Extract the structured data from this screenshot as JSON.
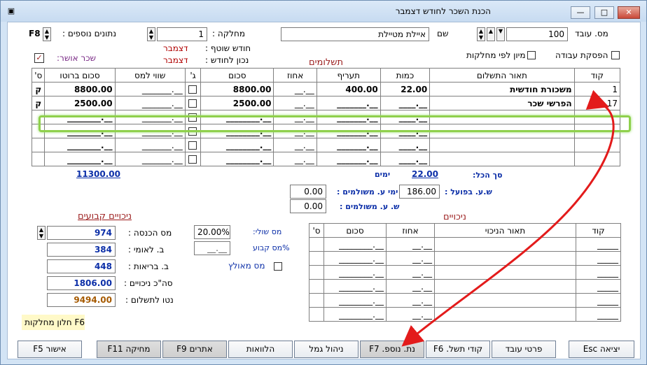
{
  "window": {
    "title": "הכנת השכר לחודש דצמבר",
    "minimize_label": "—",
    "restore_label": "□",
    "close_label": "✕",
    "app_icon": "window-app-icon"
  },
  "header": {
    "employee_no_label": "מס. עובד",
    "employee_no_value": "100",
    "name_label": "שם",
    "name_value": "איילת מטיילת",
    "department_label": "מחלקה :",
    "department_value": "1",
    "extra_data_label": "נתונים נוספים :",
    "extra_data_key": "F8",
    "stop_work_label": "הפסקת עבודה",
    "sort_by_departments_label": "מיון לפי מחלקות",
    "approved_salary_label": "שכר אושר:",
    "approved_salary_check": "✓",
    "partner_month_label": "חודש שוטף :",
    "partner_month_value": "דצמבר",
    "correct_for_month_label": "נכון לחודש :",
    "correct_for_month_value": "דצמבר"
  },
  "payments": {
    "section_title": "תשלומים",
    "columns": [
      "קוד",
      "תאור התשלום",
      "כמות",
      "תעריף",
      "אחוז",
      "סכום",
      "ג'",
      "שווי למס",
      "סכום ברוטו",
      "ס'"
    ],
    "rows": [
      {
        "code": "1",
        "desc": "משכורת חודשית",
        "qty": "22.00",
        "rate": "400.00",
        "percent": "__.__",
        "amount": "8800.00",
        "check": "",
        "tax_value": "_______.__",
        "gross": "8800.00",
        "s": "ק"
      },
      {
        "code": "17",
        "desc": "הפרשי שכר",
        "qty": "____.__",
        "rate": "_______.__",
        "percent": "__.__",
        "amount": "2500.00",
        "check": "",
        "tax_value": "_______.__",
        "gross": "2500.00",
        "s": "ק"
      },
      {
        "code": "",
        "desc": "",
        "qty": "____.__",
        "rate": "_______.__",
        "percent": "__.__",
        "amount": "________.__",
        "check": "",
        "tax_value": "_______.__",
        "gross": "________.__",
        "s": ""
      },
      {
        "code": "",
        "desc": "",
        "qty": "____.__",
        "rate": "_______.__",
        "percent": "__.__",
        "amount": "________.__",
        "check": "",
        "tax_value": "_______.__",
        "gross": "________.__",
        "s": ""
      },
      {
        "code": "",
        "desc": "",
        "qty": "____.__",
        "rate": "_______.__",
        "percent": "__.__",
        "amount": "________.__",
        "check": "",
        "tax_value": "_______.__",
        "gross": "________.__",
        "s": ""
      },
      {
        "code": "",
        "desc": "",
        "qty": "____.__",
        "rate": "_______.__",
        "percent": "__.__",
        "amount": "________.__",
        "check": "",
        "tax_value": "_______.__",
        "gross": "________.__",
        "s": ""
      }
    ],
    "total_label": "סך הכל:",
    "total_qty": "22.00",
    "days_label": "ימים",
    "gross_total": "11300.00"
  },
  "hours": {
    "actual_hours_label": "ש.ע. בפועל :",
    "actual_hours_value": "186.00",
    "paid_work_days_label": "ימי ע. משולמים :",
    "paid_work_days_value": "0.00",
    "paid_work_hours_label": "ש. ע. משולמים :",
    "paid_work_hours_value": "0.00"
  },
  "deductions": {
    "section_title": "ניכויים",
    "columns": [
      "קוד",
      "תאור הניכוי",
      "אחוז",
      "סכום",
      "ס'"
    ],
    "rows": [
      {
        "code": "_____",
        "desc": "",
        "percent": "__.__",
        "amount": "________.__",
        "s": ""
      },
      {
        "code": "_____",
        "desc": "",
        "percent": "__.__",
        "amount": "________.__",
        "s": ""
      },
      {
        "code": "_____",
        "desc": "",
        "percent": "__.__",
        "amount": "________.__",
        "s": ""
      },
      {
        "code": "_____",
        "desc": "",
        "percent": "__.__",
        "amount": "________.__",
        "s": ""
      },
      {
        "code": "_____",
        "desc": "",
        "percent": "__.__",
        "amount": "________.__",
        "s": ""
      },
      {
        "code": "_____",
        "desc": "",
        "percent": "__.__",
        "amount": "________.__",
        "s": ""
      }
    ]
  },
  "fixed_deductions": {
    "section_title": "ניכויים קבועים",
    "marginal_tax_label": "מס שולי:",
    "marginal_tax_value": "20.00%",
    "fixed_tax_label": "%מס קבוע",
    "fixed_tax_value": "__.__",
    "forced_tax_label": "מס מאולץ",
    "income_tax_label": "מס הכנסה :",
    "income_tax_value": "974",
    "national_ins_label": "ב. לאומי :",
    "national_ins_value": "384",
    "health_ins_label": "ב. בריאות :",
    "health_ins_value": "448",
    "total_deductions_label": "סה\"כ ניכויים :",
    "total_deductions_value": "1806.00",
    "net_pay_label": "נטו לתשלום :",
    "net_pay_value": "9494.00"
  },
  "footer": {
    "departments_window": "F6 חלון מחלקות",
    "buttons": {
      "exit": "יציאה Esc",
      "employee_details": "פרטי עובד",
      "payment_codes": "קודי תשל. F6",
      "extra_data": "נת. נוספ. F7",
      "provident_mgmt": "ניהול גמל",
      "loans": "הלוואות",
      "branches": "אתרים F9",
      "delete": "מחיקה F11",
      "approve": "אישור F5"
    }
  },
  "annotations": {
    "arrow_color": "#e31b1b",
    "highlight_color": "#8fd04c"
  }
}
